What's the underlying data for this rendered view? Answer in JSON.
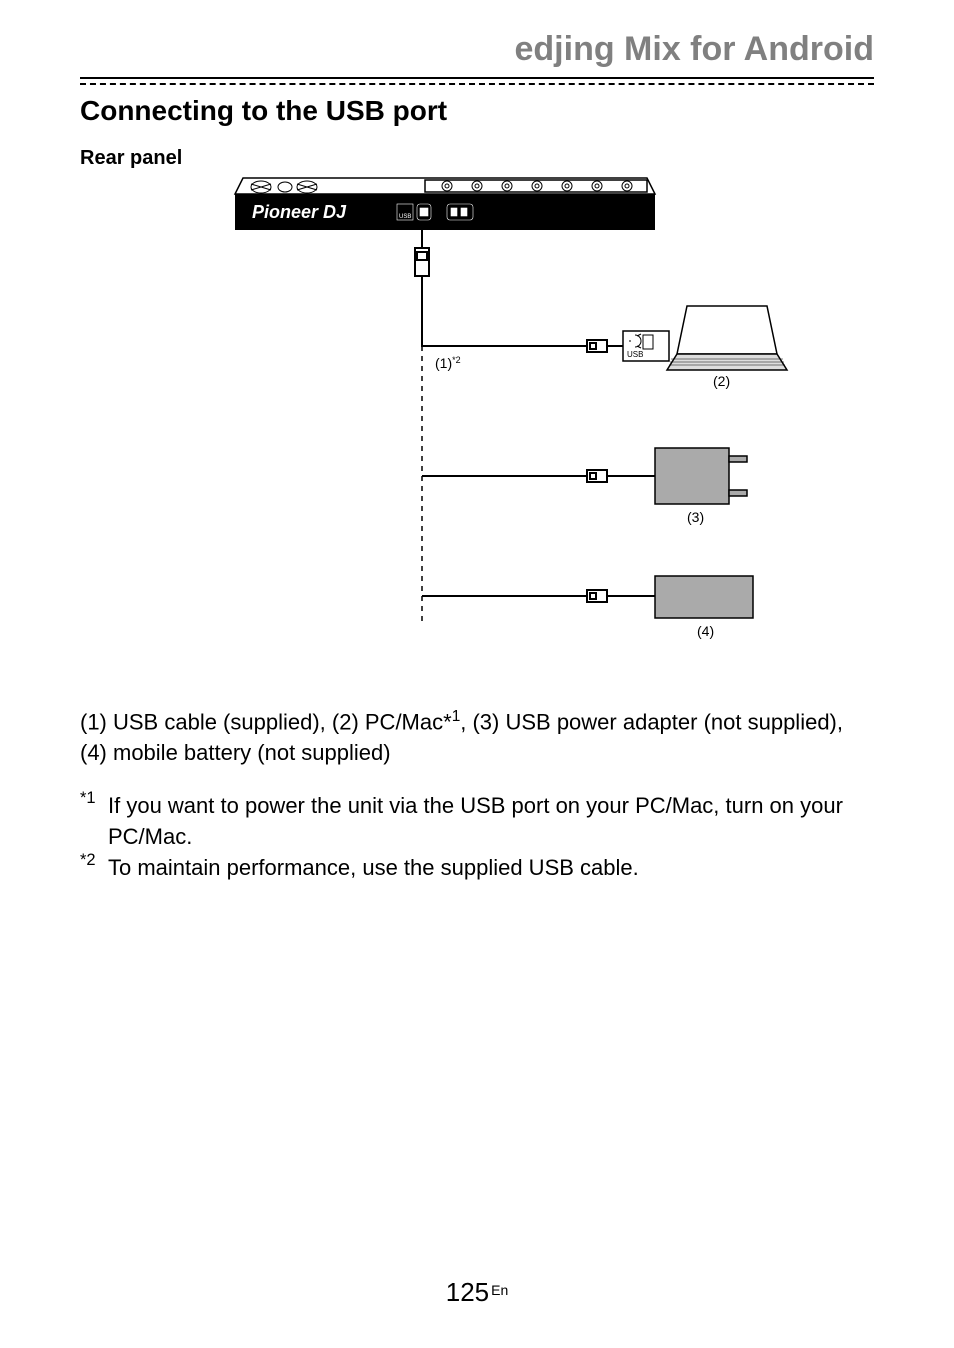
{
  "chapter_title": "edjing Mix for Android",
  "section_title": "Connecting to the USB port",
  "subhead": "Rear panel",
  "diagram": {
    "brand": "Pioneer DJ",
    "usb_icon_label": "USB",
    "callout_1": "(1)",
    "callout_1_sup": "*2",
    "label_2": "(2)",
    "label_3": "(3)",
    "label_4": "(4)",
    "usb_text": "USB"
  },
  "legend_text_1": "(1) USB cable (supplied), (2) PC/Mac*",
  "legend_sup_1": "1",
  "legend_text_2": ", (3) USB power adapter (not supplied), (4) mobile battery (not supplied)",
  "footnote_1_marker": "*1",
  "footnote_1_text": "If you want to power the unit via the USB port on your PC/Mac, turn on your PC/Mac.",
  "footnote_2_marker": "*2",
  "footnote_2_text": "To maintain performance, use the supplied USB cable.",
  "page_number": "125",
  "page_lang": "En"
}
